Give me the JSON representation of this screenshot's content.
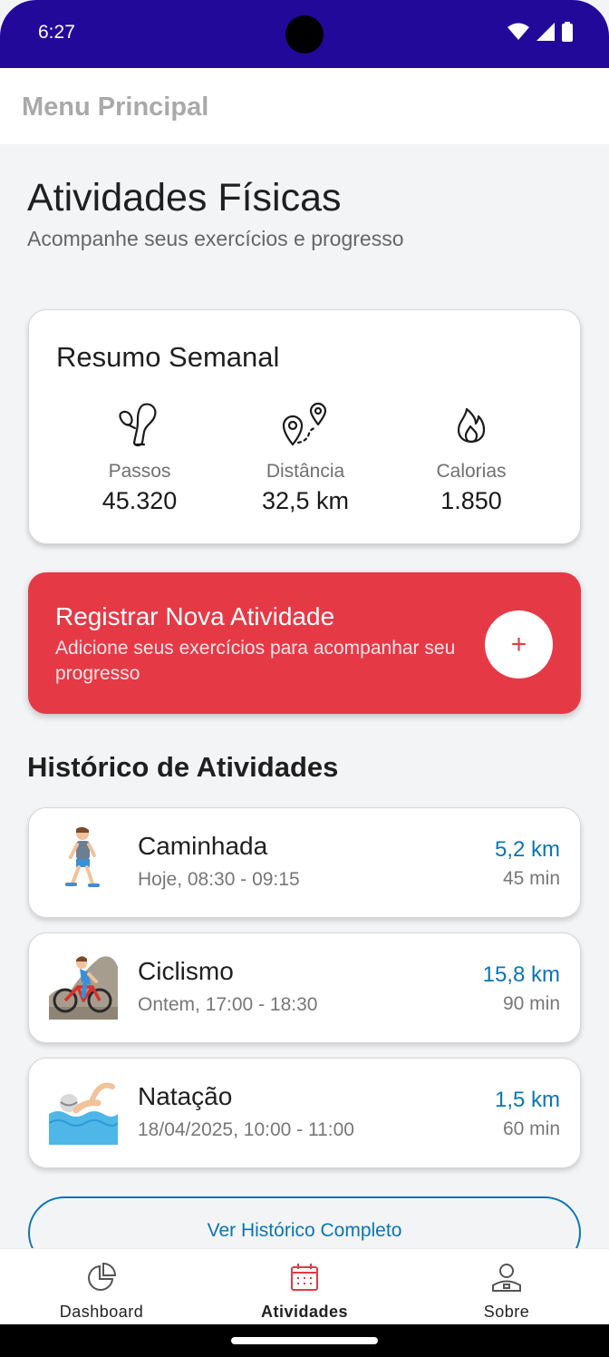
{
  "status_bar": {
    "time": "6:27"
  },
  "app_bar": {
    "title": "Menu Principal"
  },
  "header": {
    "title": "Atividades Físicas",
    "subtitle": "Acompanhe seus exercícios e progresso"
  },
  "summary": {
    "title": "Resumo Semanal",
    "stats": [
      {
        "label": "Passos",
        "value": "45.320",
        "icon": "footprints-icon"
      },
      {
        "label": "Distância",
        "value": "32,5 km",
        "icon": "map-route-icon"
      },
      {
        "label": "Calorias",
        "value": "1.850",
        "icon": "flame-icon"
      }
    ]
  },
  "cta": {
    "title": "Registrar Nova Atividade",
    "description": "Adicione seus exercícios para acompanhar seu progresso",
    "button_symbol": "+"
  },
  "history": {
    "title": "Histórico de Atividades",
    "items": [
      {
        "name": "Caminhada",
        "time": "Hoje, 08:30 - 09:15",
        "distance": "5,2 km",
        "duration": "45 min",
        "icon": "walking-person-icon"
      },
      {
        "name": "Ciclismo",
        "time": "Ontem, 17:00 - 18:30",
        "distance": "15,8 km",
        "duration": "90 min",
        "icon": "cyclist-icon"
      },
      {
        "name": "Natação",
        "time": "18/04/2025, 10:00 - 11:00",
        "distance": "1,5 km",
        "duration": "60 min",
        "icon": "swimmer-icon"
      }
    ],
    "view_all_label": "Ver Histórico Completo"
  },
  "bottom_nav": {
    "items": [
      {
        "label": "Dashboard",
        "icon": "pie-chart-icon",
        "active": false
      },
      {
        "label": "Atividades",
        "icon": "calendar-icon",
        "active": true
      },
      {
        "label": "Sobre",
        "icon": "user-badge-icon",
        "active": false
      }
    ]
  },
  "colors": {
    "status_bar": "#22099a",
    "accent_red": "#e63946",
    "accent_blue": "#0a75b3",
    "background": "#f3f4f6"
  }
}
